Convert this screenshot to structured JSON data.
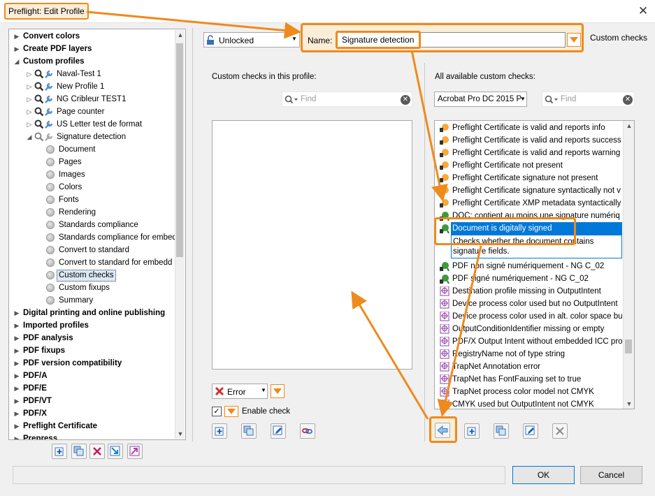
{
  "window": {
    "title": "Preflight: Edit Profile"
  },
  "tree": {
    "items": [
      {
        "label": "Convert colors",
        "bold": true,
        "level": 0,
        "toggle": "▶"
      },
      {
        "label": "Create PDF layers",
        "bold": true,
        "level": 0,
        "toggle": "▶"
      },
      {
        "label": "Custom profiles",
        "bold": true,
        "level": 0,
        "toggle": "◢"
      },
      {
        "label": "Naval-Test 1",
        "level": 1,
        "toggle": "▷",
        "icon": "profile"
      },
      {
        "label": "New Profile 1",
        "level": 1,
        "toggle": "▷",
        "icon": "profile"
      },
      {
        "label": "NG Cribleur TEST1",
        "level": 1,
        "toggle": "▷",
        "icon": "profile"
      },
      {
        "label": "Page counter",
        "level": 1,
        "toggle": "▷",
        "icon": "profile"
      },
      {
        "label": "US Letter test de format",
        "level": 1,
        "toggle": "▷",
        "icon": "profile"
      },
      {
        "label": "Signature detection",
        "level": 1,
        "toggle": "◢",
        "icon": "profile-gray"
      },
      {
        "label": "Document",
        "level": 2,
        "icon": "dot"
      },
      {
        "label": "Pages",
        "level": 2,
        "icon": "dot"
      },
      {
        "label": "Images",
        "level": 2,
        "icon": "dot"
      },
      {
        "label": "Colors",
        "level": 2,
        "icon": "dot"
      },
      {
        "label": "Fonts",
        "level": 2,
        "icon": "dot"
      },
      {
        "label": "Rendering",
        "level": 2,
        "icon": "dot"
      },
      {
        "label": "Standards compliance",
        "level": 2,
        "icon": "dot"
      },
      {
        "label": "Standards compliance for embed",
        "level": 2,
        "icon": "dot"
      },
      {
        "label": "Convert to standard",
        "level": 2,
        "icon": "dot"
      },
      {
        "label": "Convert to standard for embedd",
        "level": 2,
        "icon": "dot"
      },
      {
        "label": "Custom checks",
        "level": 2,
        "icon": "dot",
        "selected": true
      },
      {
        "label": "Custom fixups",
        "level": 2,
        "icon": "dot"
      },
      {
        "label": "Summary",
        "level": 2,
        "icon": "dot"
      },
      {
        "label": "Digital printing and online publishing",
        "bold": true,
        "level": 0,
        "toggle": "▶"
      },
      {
        "label": "Imported profiles",
        "bold": true,
        "level": 0,
        "toggle": "▶"
      },
      {
        "label": "PDF analysis",
        "bold": true,
        "level": 0,
        "toggle": "▶"
      },
      {
        "label": "PDF fixups",
        "bold": true,
        "level": 0,
        "toggle": "▶"
      },
      {
        "label": "PDF version compatibility",
        "bold": true,
        "level": 0,
        "toggle": "▶"
      },
      {
        "label": "PDF/A",
        "bold": true,
        "level": 0,
        "toggle": "▶"
      },
      {
        "label": "PDF/E",
        "bold": true,
        "level": 0,
        "toggle": "▶"
      },
      {
        "label": "PDF/VT",
        "bold": true,
        "level": 0,
        "toggle": "▶"
      },
      {
        "label": "PDF/X",
        "bold": true,
        "level": 0,
        "toggle": "▶"
      },
      {
        "label": "Preflight Certificate",
        "bold": true,
        "level": 0,
        "toggle": "▶"
      },
      {
        "label": "Prepress",
        "bold": true,
        "level": 0,
        "toggle": "▶"
      }
    ]
  },
  "profile": {
    "lock_state": "Unlocked",
    "name_label": "Name:",
    "name_value": "Signature detection",
    "section_title": "Custom checks"
  },
  "middle": {
    "label": "Custom checks in this profile:",
    "find_placeholder": "Find",
    "severity": "Error",
    "enable_check_label": "Enable check",
    "enable_check_checked": true
  },
  "right": {
    "label": "All available custom checks:",
    "version": "Acrobat Pro DC 2015 P",
    "find_placeholder": "Find",
    "items": [
      {
        "text": "Preflight Certificate is valid and reports info",
        "icon": "cert"
      },
      {
        "text": "Preflight Certificate is valid and reports success",
        "icon": "cert"
      },
      {
        "text": "Preflight Certificate is valid and reports warning",
        "icon": "cert"
      },
      {
        "text": "Preflight Certificate not present",
        "icon": "cert"
      },
      {
        "text": "Preflight Certificate signature not present",
        "icon": "cert"
      },
      {
        "text": "Preflight Certificate signature syntactically not v",
        "icon": "cert"
      },
      {
        "text": "Preflight Certificate XMP metadata syntactically",
        "icon": "cert"
      },
      {
        "text": "DOC: contient au moins une signature numériq",
        "icon": "ribbon"
      },
      {
        "text": "Document is digitally signed",
        "icon": "ribbon",
        "selected": true,
        "description": "Checks whether the document contains signature fields."
      },
      {
        "text": "PDF non signé numériquement - NG C_02",
        "icon": "ribbon"
      },
      {
        "text": "PDF signé numériquement - NG C_02",
        "icon": "ribbon"
      },
      {
        "text": "Destination profile missing in OutputIntent",
        "icon": "target"
      },
      {
        "text": "Device process color used but no OutputIntent",
        "icon": "target"
      },
      {
        "text": "Device process color used in alt. color space bu",
        "icon": "target"
      },
      {
        "text": "OutputConditionIdentifier missing or empty",
        "icon": "target"
      },
      {
        "text": "PDF/X Output Intent without embedded ICC pro",
        "icon": "target"
      },
      {
        "text": "RegistryName not of type string",
        "icon": "target"
      },
      {
        "text": "TrapNet Annotation error",
        "icon": "target"
      },
      {
        "text": "TrapNet has FontFauxing set to true",
        "icon": "target"
      },
      {
        "text": "TrapNet process color model not CMYK",
        "icon": "target"
      },
      {
        "text": "CMYK used but OutputIntent not CMYK",
        "icon": "target"
      }
    ]
  },
  "buttons": {
    "ok": "OK",
    "cancel": "Cancel"
  },
  "colors": {
    "annotation": "#ef8a1c",
    "selection": "#0078d7"
  }
}
